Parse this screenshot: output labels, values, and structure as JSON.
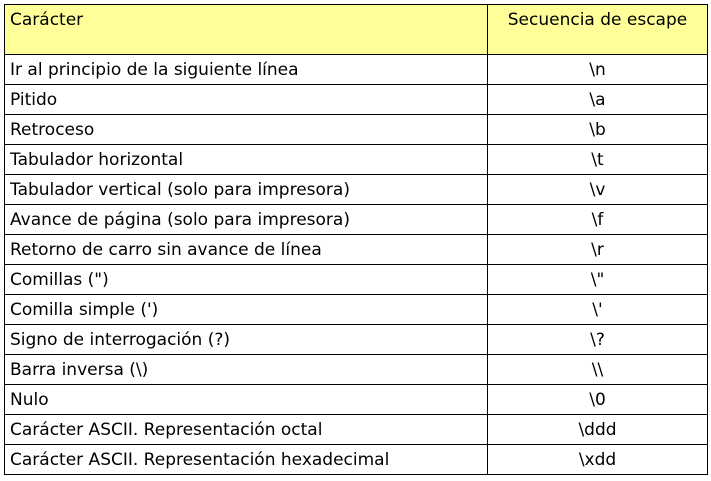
{
  "table": {
    "headers": [
      "Carácter",
      "Secuencia de escape"
    ],
    "rows": [
      [
        "Ir al principio de la siguiente línea",
        "\\n"
      ],
      [
        "Pitido",
        "\\a"
      ],
      [
        "Retroceso",
        "\\b"
      ],
      [
        "Tabulador horizontal",
        "\\t"
      ],
      [
        "Tabulador vertical (solo para impresora)",
        "\\v"
      ],
      [
        "Avance de página (solo para impresora)",
        "\\f"
      ],
      [
        "Retorno de carro sin avance de línea",
        "\\r"
      ],
      [
        "Comillas (\")",
        "\\\""
      ],
      [
        "Comilla simple (')",
        "\\'"
      ],
      [
        "Signo de interrogación (?)",
        "\\?"
      ],
      [
        "Barra inversa (\\)",
        "\\\\"
      ],
      [
        "Nulo",
        "\\0"
      ],
      [
        "Carácter ASCII. Representación octal",
        "\\ddd"
      ],
      [
        "Carácter ASCII. Representación hexadecimal",
        "\\xdd"
      ]
    ]
  },
  "colors": {
    "header_background": "#ffff99",
    "border": "#000000"
  }
}
